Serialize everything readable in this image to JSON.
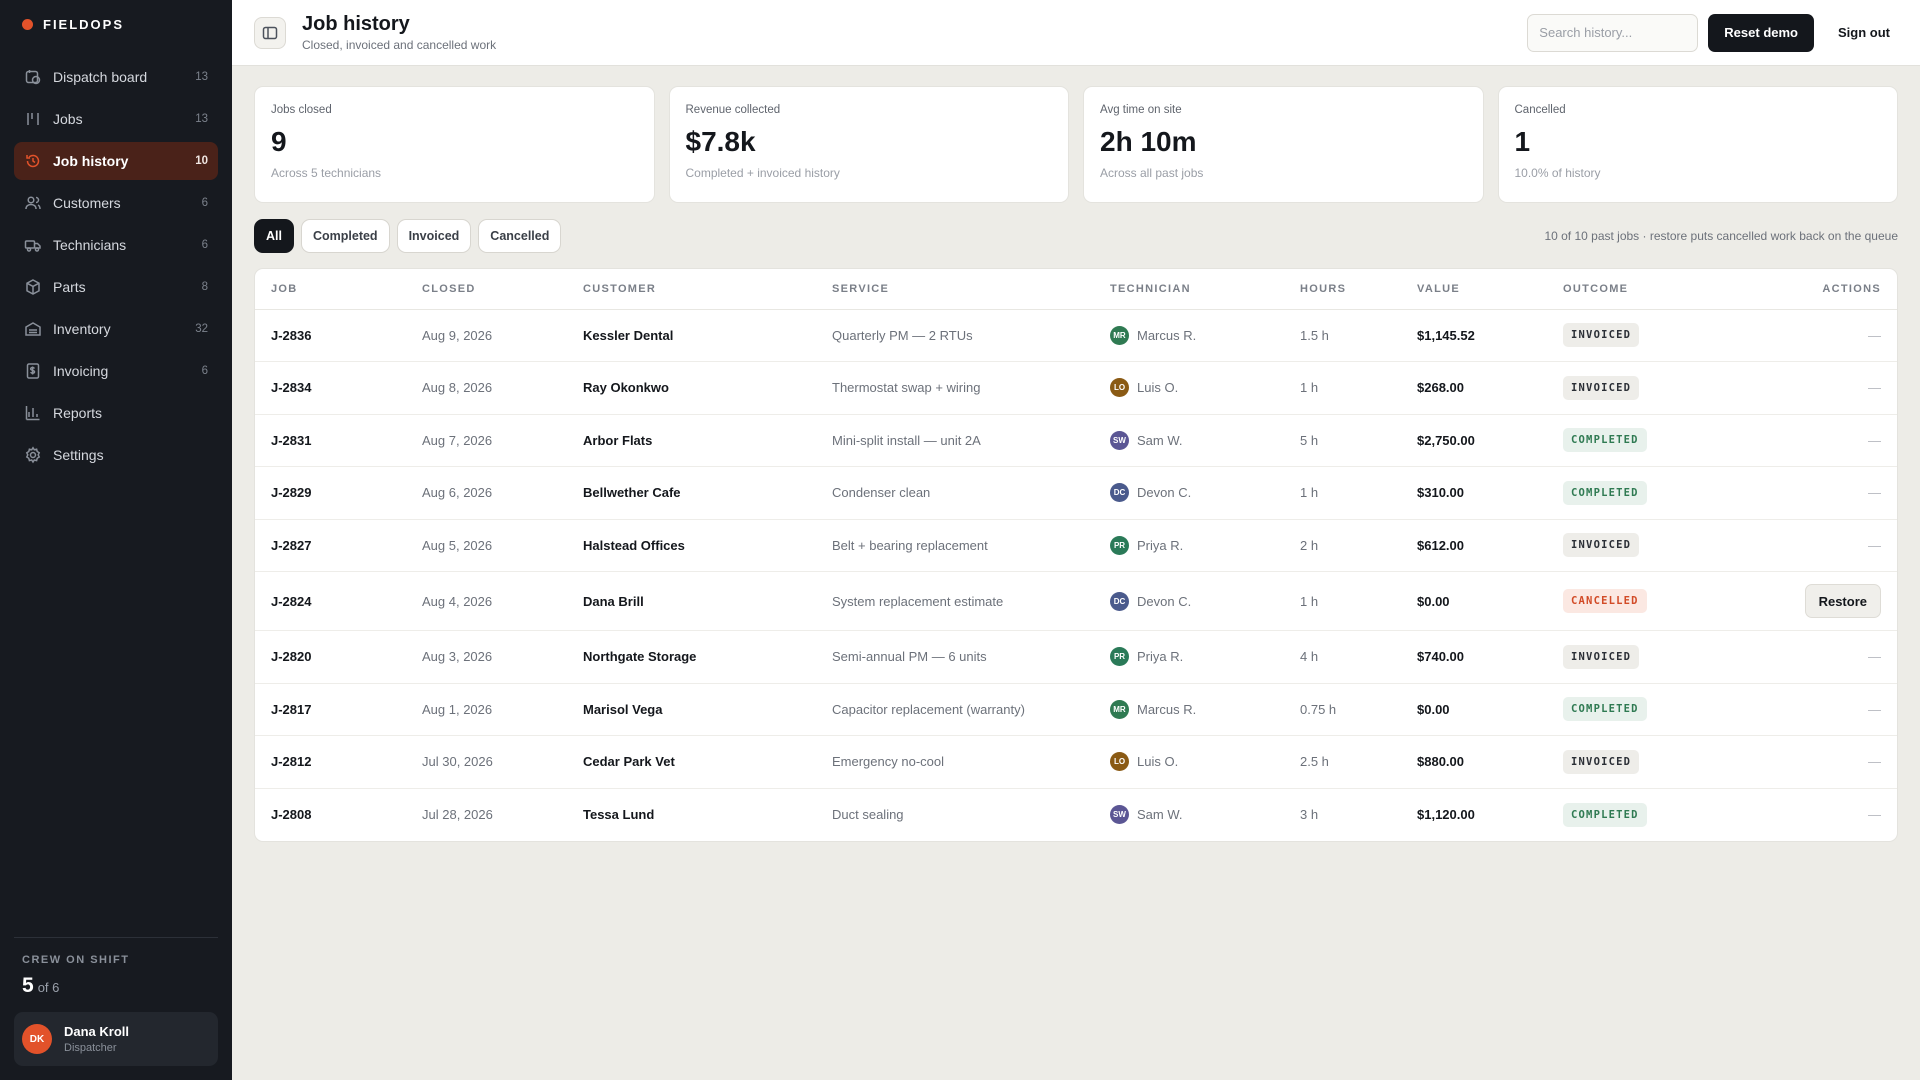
{
  "brand": {
    "name": "FIELDOPS"
  },
  "nav": [
    {
      "label": "Dispatch board",
      "count": "13",
      "icon": "dispatch-icon",
      "active": false
    },
    {
      "label": "Jobs",
      "count": "13",
      "icon": "jobs-icon",
      "active": false
    },
    {
      "label": "Job history",
      "count": "10",
      "icon": "history-icon",
      "active": true
    },
    {
      "label": "Customers",
      "count": "6",
      "icon": "customers-icon",
      "active": false
    },
    {
      "label": "Technicians",
      "count": "6",
      "icon": "truck-icon",
      "active": false
    },
    {
      "label": "Parts",
      "count": "8",
      "icon": "box-icon",
      "active": false
    },
    {
      "label": "Inventory",
      "count": "32",
      "icon": "warehouse-icon",
      "active": false
    },
    {
      "label": "Invoicing",
      "count": "6",
      "icon": "invoice-icon",
      "active": false
    },
    {
      "label": "Reports",
      "count": "",
      "icon": "chart-icon",
      "active": false
    },
    {
      "label": "Settings",
      "count": "",
      "icon": "gear-icon",
      "active": false
    }
  ],
  "crew": {
    "title": "CREW ON SHIFT",
    "on": "5",
    "of": "of 6"
  },
  "user": {
    "initials": "DK",
    "name": "Dana Kroll",
    "role": "Dispatcher"
  },
  "header": {
    "title": "Job history",
    "subtitle": "Closed, invoiced and cancelled work",
    "search_placeholder": "Search history...",
    "reset_label": "Reset demo",
    "signout_label": "Sign out"
  },
  "stats": [
    {
      "label": "Jobs closed",
      "value": "9",
      "note": "Across 5 technicians"
    },
    {
      "label": "Revenue collected",
      "value": "$7.8k",
      "note": "Completed + invoiced history"
    },
    {
      "label": "Avg time on site",
      "value": "2h 10m",
      "note": "Across all past jobs"
    },
    {
      "label": "Cancelled",
      "value": "1",
      "note": "10.0% of history"
    }
  ],
  "filters": {
    "chips": [
      "All",
      "Completed",
      "Invoiced",
      "Cancelled"
    ],
    "active": "All",
    "note": "10 of 10 past jobs · restore puts cancelled work back on the queue"
  },
  "table": {
    "columns": [
      "JOB",
      "CLOSED",
      "CUSTOMER",
      "SERVICE",
      "TECHNICIAN",
      "HOURS",
      "VALUE",
      "OUTCOME",
      "ACTIONS"
    ],
    "rows": [
      {
        "job": "J-2836",
        "closed": "Aug 9, 2026",
        "customer": "Kessler Dental",
        "service": "Quarterly PM — 2 RTUs",
        "tech_initials": "MR",
        "tech": "Marcus R.",
        "tech_color": "#2f7a52",
        "hours": "1.5 h",
        "value": "$1,145.52",
        "outcome": "INVOICED",
        "action": "—"
      },
      {
        "job": "J-2834",
        "closed": "Aug 8, 2026",
        "customer": "Ray Okonkwo",
        "service": "Thermostat swap + wiring",
        "tech_initials": "LO",
        "tech": "Luis O.",
        "tech_color": "#8a5a14",
        "hours": "1 h",
        "value": "$268.00",
        "outcome": "INVOICED",
        "action": "—"
      },
      {
        "job": "J-2831",
        "closed": "Aug 7, 2026",
        "customer": "Arbor Flats",
        "service": "Mini-split install — unit 2A",
        "tech_initials": "SW",
        "tech": "Sam W.",
        "tech_color": "#5b5694",
        "hours": "5 h",
        "value": "$2,750.00",
        "outcome": "COMPLETED",
        "action": "—"
      },
      {
        "job": "J-2829",
        "closed": "Aug 6, 2026",
        "customer": "Bellwether Cafe",
        "service": "Condenser clean",
        "tech_initials": "DC",
        "tech": "Devon C.",
        "tech_color": "#4a5a8c",
        "hours": "1 h",
        "value": "$310.00",
        "outcome": "COMPLETED",
        "action": "—"
      },
      {
        "job": "J-2827",
        "closed": "Aug 5, 2026",
        "customer": "Halstead Offices",
        "service": "Belt + bearing replacement",
        "tech_initials": "PR",
        "tech": "Priya R.",
        "tech_color": "#2a7a58",
        "hours": "2 h",
        "value": "$612.00",
        "outcome": "INVOICED",
        "action": "—"
      },
      {
        "job": "J-2824",
        "closed": "Aug 4, 2026",
        "customer": "Dana Brill",
        "service": "System replacement estimate",
        "tech_initials": "DC",
        "tech": "Devon C.",
        "tech_color": "#4a5a8c",
        "hours": "1 h",
        "value": "$0.00",
        "outcome": "CANCELLED",
        "action": "Restore"
      },
      {
        "job": "J-2820",
        "closed": "Aug 3, 2026",
        "customer": "Northgate Storage",
        "service": "Semi-annual PM — 6 units",
        "tech_initials": "PR",
        "tech": "Priya R.",
        "tech_color": "#2a7a58",
        "hours": "4 h",
        "value": "$740.00",
        "outcome": "INVOICED",
        "action": "—"
      },
      {
        "job": "J-2817",
        "closed": "Aug 1, 2026",
        "customer": "Marisol Vega",
        "service": "Capacitor replacement (warranty)",
        "tech_initials": "MR",
        "tech": "Marcus R.",
        "tech_color": "#2f7a52",
        "hours": "0.75 h",
        "value": "$0.00",
        "outcome": "COMPLETED",
        "action": "—"
      },
      {
        "job": "J-2812",
        "closed": "Jul 30, 2026",
        "customer": "Cedar Park Vet",
        "service": "Emergency no-cool",
        "tech_initials": "LO",
        "tech": "Luis O.",
        "tech_color": "#8a5a14",
        "hours": "2.5 h",
        "value": "$880.00",
        "outcome": "INVOICED",
        "action": "—"
      },
      {
        "job": "J-2808",
        "closed": "Jul 28, 2026",
        "customer": "Tessa Lund",
        "service": "Duct sealing",
        "tech_initials": "SW",
        "tech": "Sam W.",
        "tech_color": "#5b5694",
        "hours": "3 h",
        "value": "$1,120.00",
        "outcome": "COMPLETED",
        "action": "—"
      }
    ]
  }
}
